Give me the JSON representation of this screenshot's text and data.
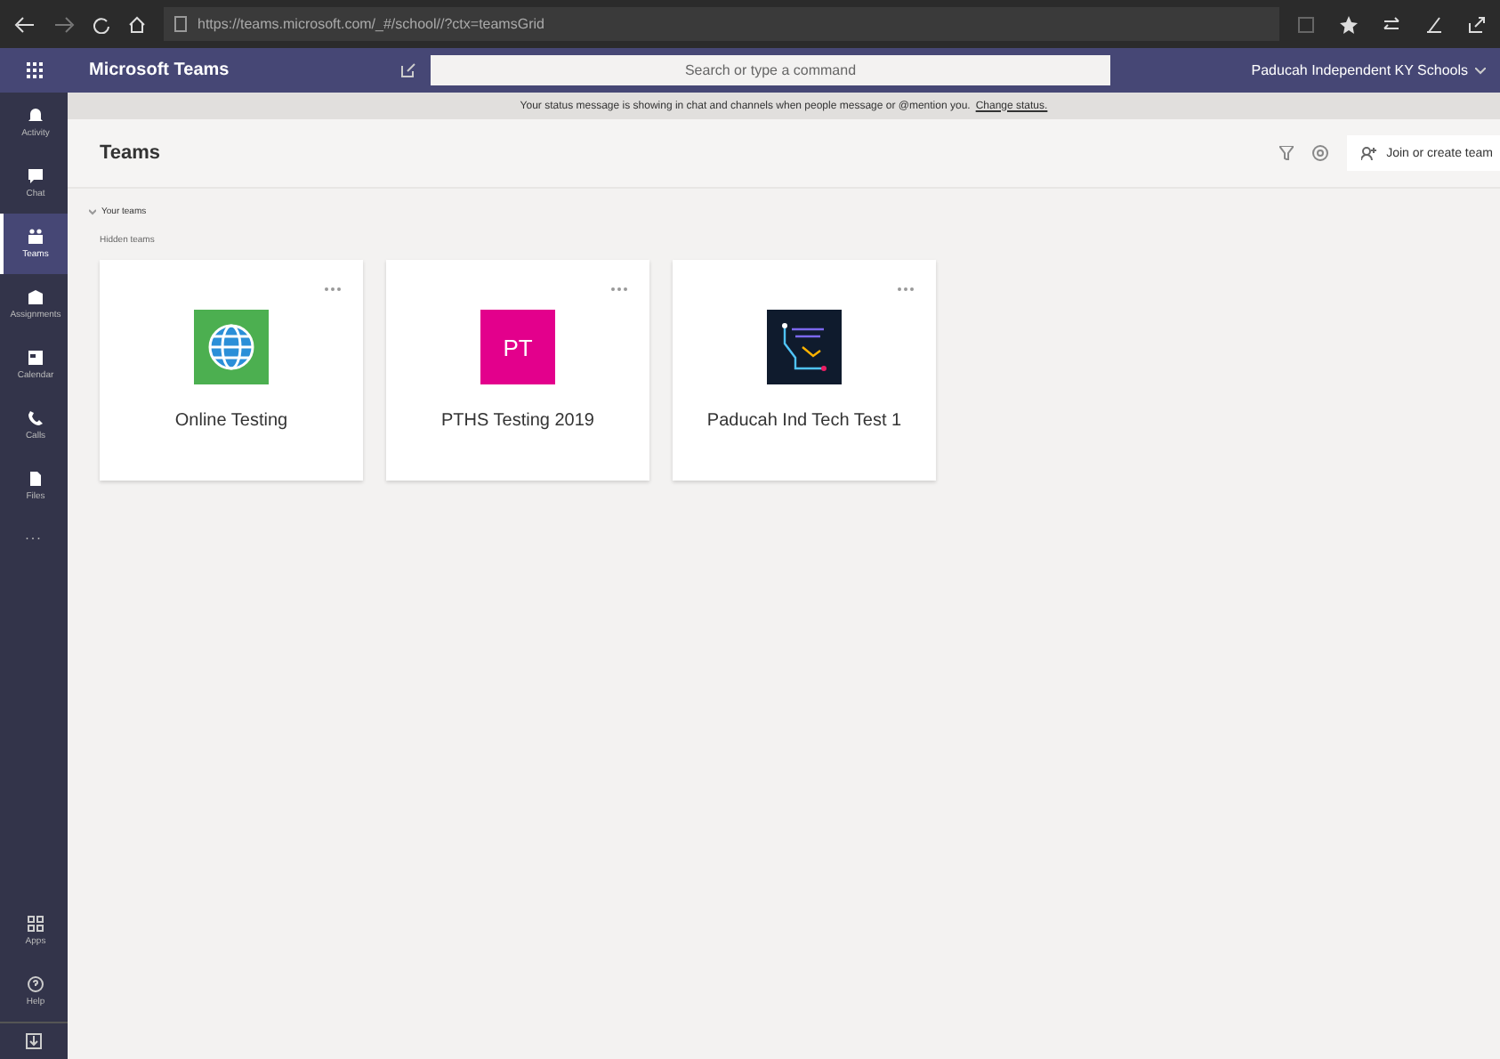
{
  "browser": {
    "url": "https://teams.microsoft.com/_#/school//?ctx=teamsGrid"
  },
  "header": {
    "app_name": "Microsoft Teams",
    "search": {
      "placeholder": "Search or type a command"
    },
    "org": "Paducah Independent KY Schools"
  },
  "rail": {
    "items": [
      {
        "label": "Activity",
        "selected": false
      },
      {
        "label": "Chat",
        "selected": false
      },
      {
        "label": "Teams",
        "selected": true
      },
      {
        "label": "Assignments",
        "selected": false
      },
      {
        "label": "Calendar",
        "selected": false
      },
      {
        "label": "Calls",
        "selected": false
      },
      {
        "label": "Files",
        "selected": false
      }
    ],
    "more": "...",
    "bottom_items": [
      {
        "label": "Apps",
        "selected": false
      },
      {
        "label": "Help",
        "selected": false
      }
    ]
  },
  "banner": {
    "text": "Your status message is showing in chat and channels when people message or @mention you.",
    "link": "Change status."
  },
  "page": {
    "title": "Teams",
    "join_button": "Join or create team",
    "section": "Your teams",
    "subsection": "Hidden teams",
    "teams": [
      {
        "name": "Online Testing",
        "kind": "globe",
        "color": "#4caf50"
      },
      {
        "name": "PTHS Testing 2019",
        "kind": "initials",
        "color": "#e3008c",
        "initials": "PT"
      },
      {
        "name": "Paducah Ind Tech Test 1",
        "kind": "circuit",
        "color": "#0f1b2d"
      }
    ]
  }
}
